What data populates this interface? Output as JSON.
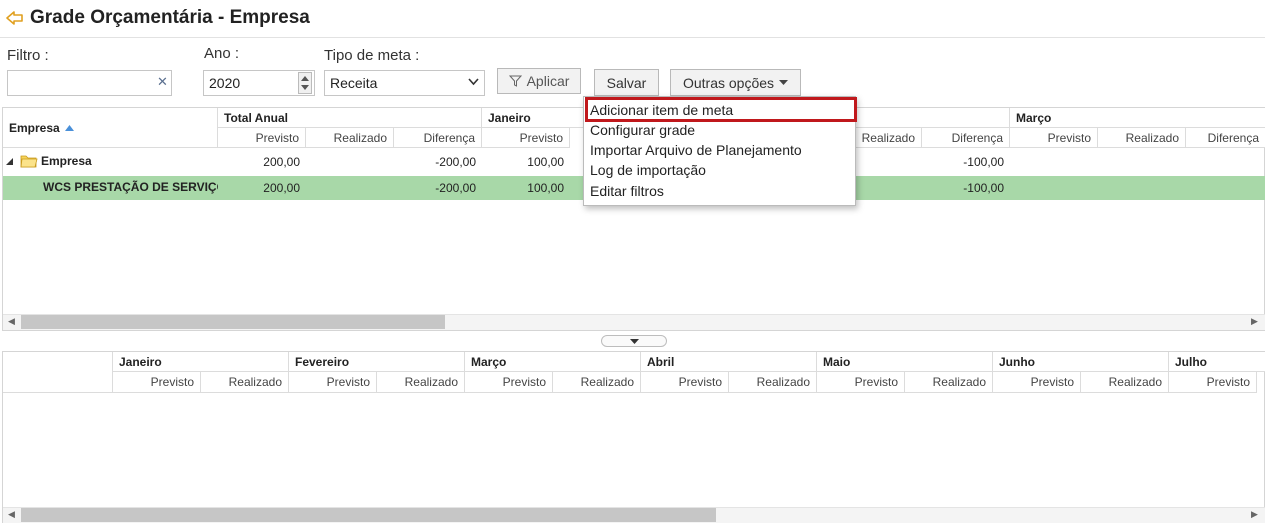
{
  "header": {
    "title": "Grade Orçamentária - Empresa"
  },
  "filters": {
    "filtro_label": "Filtro :",
    "filtro_value": "",
    "ano_label": "Ano :",
    "ano_value": "2020",
    "tipo_label": "Tipo de meta :",
    "tipo_value": "Receita",
    "aplicar_label": "Aplicar",
    "salvar_label": "Salvar",
    "outras_label": "Outras opções"
  },
  "menu": {
    "items": [
      "Adicionar item de meta",
      "Configurar grade",
      "Importar Arquivo de Planejamento",
      "Log de importação",
      "Editar filtros"
    ]
  },
  "top_grid": {
    "empresa_header": "Empresa",
    "groups": [
      "Total Anual",
      "Janeiro",
      "Março"
    ],
    "sub": [
      "Previsto",
      "Realizado",
      "Diferença",
      "Previsto",
      "Realizado",
      "Diferença",
      "Previsto",
      "Realizado",
      "Diferença"
    ],
    "rows": [
      {
        "name": "Empresa",
        "total_prev": "200,00",
        "total_dif": "-200,00",
        "jan_prev": "100,00",
        "fev_dif": "-100,00"
      },
      {
        "name": "WCS PRESTAÇÃO DE SERVIÇOS",
        "total_prev": "200,00",
        "total_dif": "-200,00",
        "jan_prev": "100,00",
        "fev_dif": "-100,00"
      }
    ]
  },
  "bottom_grid": {
    "months": [
      "Janeiro",
      "Fevereiro",
      "Março",
      "Abril",
      "Maio",
      "Junho",
      "Julho"
    ],
    "sub": [
      "Previsto",
      "Realizado",
      "Previsto",
      "Realizado",
      "Previsto",
      "Realizado",
      "Previsto",
      "Realizado",
      "Previsto",
      "Realizado",
      "Previsto",
      "Realizado",
      "Previsto"
    ]
  },
  "colors": {
    "selected_row": "#a8d8a8",
    "menu_highlight": "#c0181c",
    "back_icon": "#e0a020"
  }
}
